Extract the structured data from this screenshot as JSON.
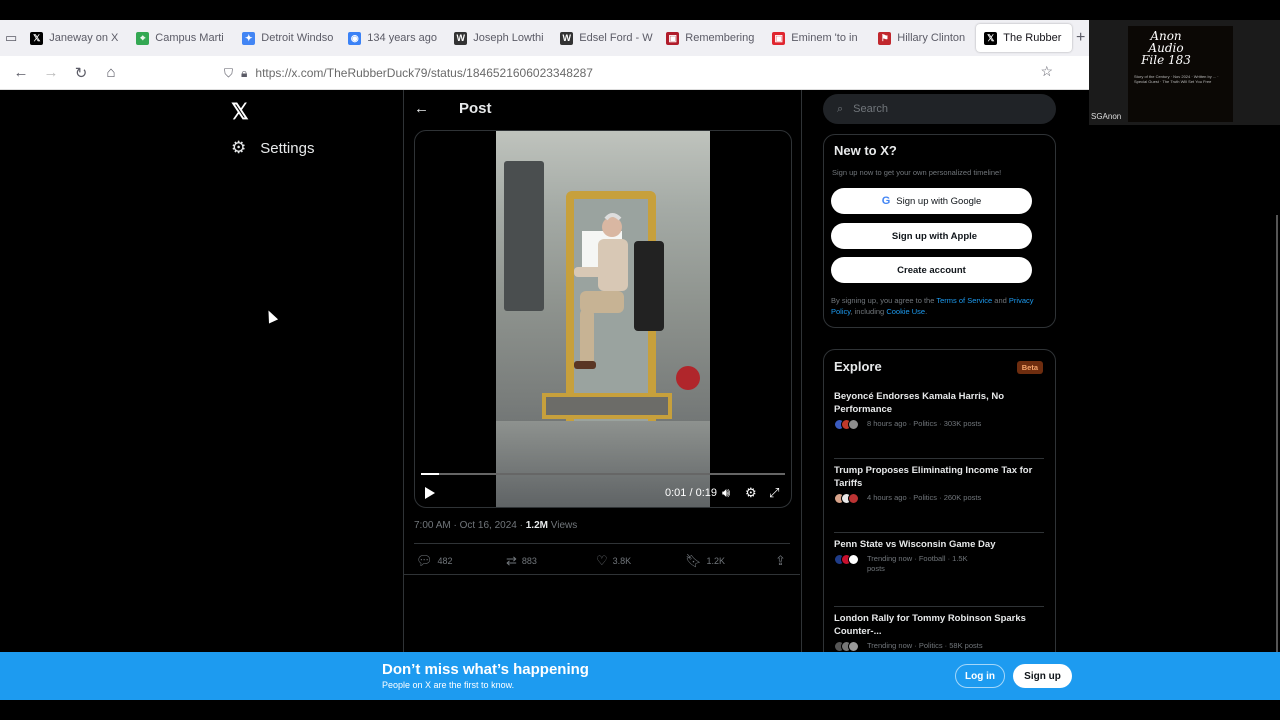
{
  "browser": {
    "tabs": [
      {
        "label": "Janeway on X",
        "icon": "x-logo-icon",
        "color": "#000000"
      },
      {
        "label": "Campus Marti",
        "icon": "map-pin-icon",
        "color": "#34a853"
      },
      {
        "label": "Detroit Windso",
        "icon": "sparkle-icon",
        "color": "#4285f4"
      },
      {
        "label": "134 years ago",
        "icon": "globe-icon",
        "color": "#3b82f6"
      },
      {
        "label": "Joseph Lowthi",
        "icon": "wikipedia-icon",
        "color": "#333333"
      },
      {
        "label": "Edsel Ford - W",
        "icon": "wikipedia-icon",
        "color": "#333333"
      },
      {
        "label": "Remembering",
        "icon": "news-icon",
        "color": "#b11c2b"
      },
      {
        "label": "Eminem 'to in",
        "icon": "news-icon",
        "color": "#e0262f"
      },
      {
        "label": "Hillary Clinton",
        "icon": "flag-icon",
        "color": "#c1272d"
      },
      {
        "label": "The Rubber",
        "icon": "x-logo-icon",
        "color": "#000000",
        "active": true
      }
    ],
    "url": "https://x.com/TheRubberDuck79/status/1846521606023348287"
  },
  "overlay": {
    "cam_label": "SGAnon",
    "audio_title": "Anon Audio File 183",
    "audio_lines": "Story of the Century · Nov 2024 · Written by ... · Special Guest · The Truth Will Set You Free"
  },
  "sidebar": {
    "settings_label": "Settings"
  },
  "post": {
    "header": "Post",
    "video": {
      "time": "0:01 / 0:19",
      "progress": 0.05
    },
    "timestamp": "7:00 AM · Oct 16, 2024 · ",
    "views_count": "1.2M",
    "views_label": " Views",
    "replies": "482",
    "reposts": "883",
    "likes": "3.8K",
    "bookmarks": "1.2K"
  },
  "right": {
    "search_placeholder": "Search",
    "new_to_x": {
      "title": "New to X?",
      "subtitle": "Sign up now to get your own personalized timeline!",
      "google": "Sign up with Google",
      "apple": "Sign up with Apple",
      "create": "Create account",
      "terms_pre": "By signing up, you agree to the ",
      "terms_link": "Terms of Service",
      "terms_mid": " and ",
      "privacy_link": "Privacy Policy",
      "terms_mid2": ", including ",
      "cookie_link": "Cookie Use",
      "terms_end": "."
    },
    "explore": {
      "title": "Explore",
      "badge": "Beta",
      "trends": [
        {
          "title": "Beyoncé Endorses Kamala Harris, No Performance",
          "meta": "8 hours ago · Politics · 303K posts",
          "avatars": [
            "#3a5bbf",
            "#c0392b",
            "#8e8e8e"
          ]
        },
        {
          "title": "Trump Proposes Eliminating Income Tax for Tariffs",
          "meta": "4 hours ago · Politics · 260K posts",
          "avatars": [
            "#d7a38a",
            "#e9e9e9",
            "#b33"
          ]
        },
        {
          "title": "Penn State vs Wisconsin Game Day",
          "meta": "Trending now · Football · 1.5K posts",
          "avatars": [
            "#1f3c88",
            "#c8102e",
            "#ffffff"
          ]
        },
        {
          "title": "London Rally for Tommy Robinson Sparks Counter-...",
          "meta": "Trending now · Politics · 58K posts",
          "avatars": [
            "#555",
            "#777",
            "#999"
          ]
        }
      ]
    }
  },
  "banner": {
    "headline": "Don’t miss what’s happening",
    "sub": "People on X are the first to know.",
    "login": "Log in",
    "signup": "Sign up"
  }
}
